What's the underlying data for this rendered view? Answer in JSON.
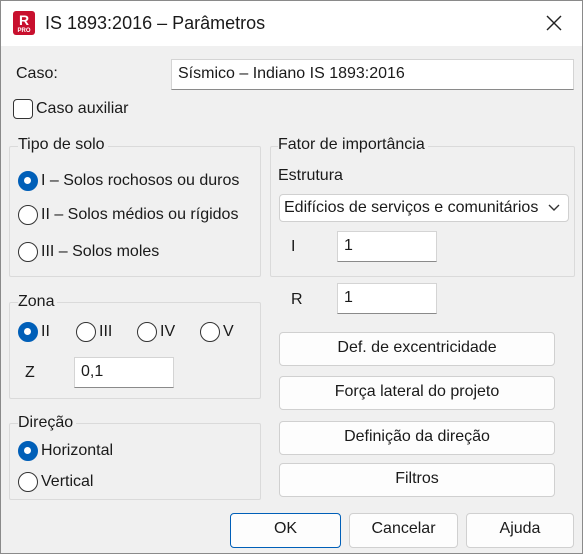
{
  "window": {
    "title": "IS 1893:2016 – Parâmetros",
    "icon_letter": "R",
    "icon_badge": "PRO"
  },
  "caso": {
    "label": "Caso:",
    "value": "Sísmico – Indiano IS 1893:2016"
  },
  "caso_auxiliar": {
    "label": "Caso auxiliar",
    "checked": false
  },
  "tipo_solo": {
    "title": "Tipo de solo",
    "options": [
      {
        "label": "I – Solos rochosos ou duros",
        "selected": true
      },
      {
        "label": "II – Solos médios ou rígidos",
        "selected": false
      },
      {
        "label": "III – Solos moles",
        "selected": false
      }
    ]
  },
  "zona": {
    "title": "Zona",
    "options": [
      {
        "label": "II",
        "selected": true
      },
      {
        "label": "III",
        "selected": false
      },
      {
        "label": "IV",
        "selected": false
      },
      {
        "label": "V",
        "selected": false
      }
    ],
    "z_label": "Z",
    "z_value": "0,1"
  },
  "direcao": {
    "title": "Direção",
    "options": [
      {
        "label": "Horizontal",
        "selected": true
      },
      {
        "label": "Vertical",
        "selected": false
      }
    ]
  },
  "importancia": {
    "title": "Fator de importância",
    "estrutura_label": "Estrutura",
    "estrutura_value": "Edifícios de serviços e comunitários",
    "i_label": "I",
    "i_value": "1",
    "r_label": "R",
    "r_value": "1"
  },
  "actions": {
    "excentricidade": "Def. de excentricidade",
    "forca_lateral": "Força lateral do projeto",
    "definicao_direcao": "Definição da direção",
    "filtros": "Filtros"
  },
  "footer": {
    "ok": "OK",
    "cancel": "Cancelar",
    "help": "Ajuda"
  },
  "colors": {
    "accent": "#005fb8",
    "app_icon": "#c8102e"
  }
}
